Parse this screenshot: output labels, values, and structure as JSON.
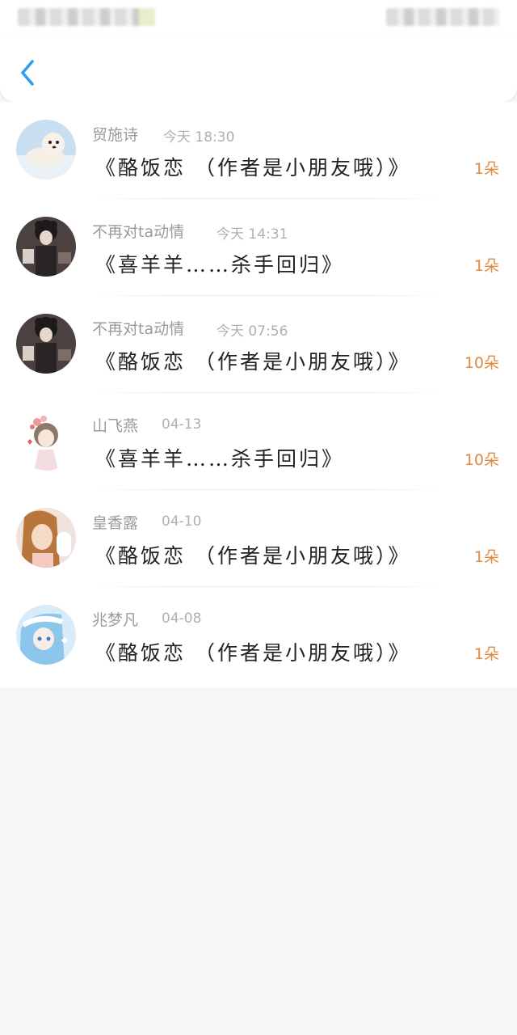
{
  "header": {
    "back_icon": "chevron-left-icon",
    "accent_color": "#2c9bf0"
  },
  "colors": {
    "count": "#e08a3e",
    "name": "#9a9a9a",
    "time": "#b0b0b0",
    "title": "#222222"
  },
  "gifts": [
    {
      "name": "贸施诗",
      "time": "今天 18:30",
      "title": "《酪饭恋 （作者是小朋友哦）》",
      "count": "1朵"
    },
    {
      "name": "不再对ta动情",
      "time": "今天 14:31",
      "title": "《喜羊羊……杀手回归》",
      "count": "1朵"
    },
    {
      "name": "不再对ta动情",
      "time": "今天 07:56",
      "title": "《酪饭恋 （作者是小朋友哦）》",
      "count": "10朵"
    },
    {
      "name": "山飞燕",
      "time": "04-13",
      "title": "《喜羊羊……杀手回归》",
      "count": "10朵"
    },
    {
      "name": "皇香露",
      "time": "04-10",
      "title": "《酪饭恋 （作者是小朋友哦）》",
      "count": "1朵"
    },
    {
      "name": "兆梦凡",
      "time": "04-08",
      "title": "《酪饭恋 （作者是小朋友哦）》",
      "count": "1朵"
    }
  ]
}
